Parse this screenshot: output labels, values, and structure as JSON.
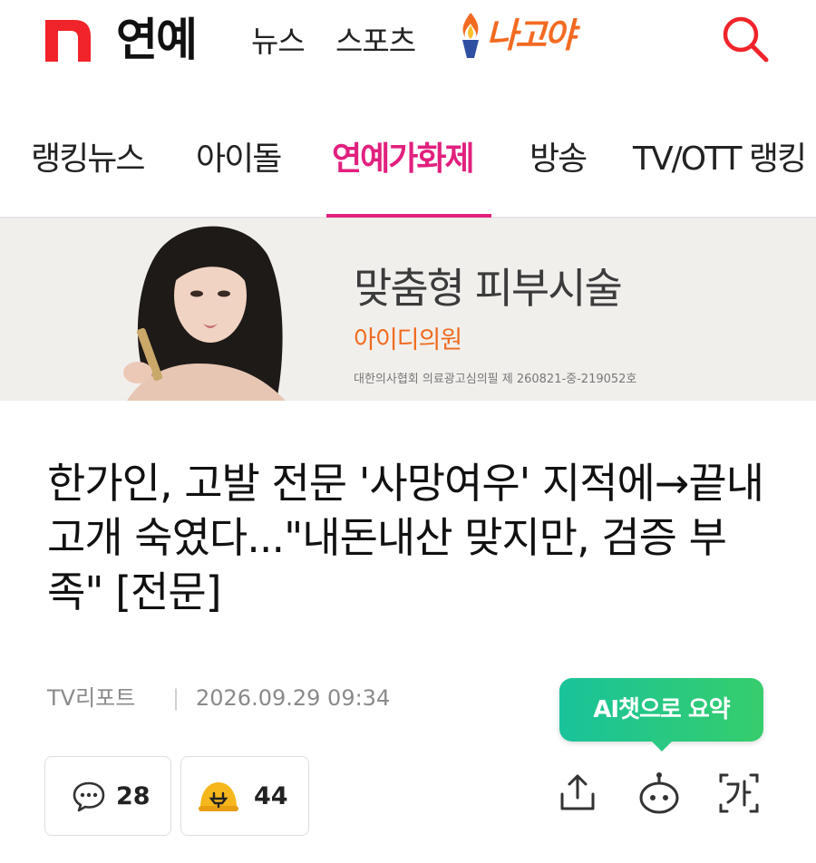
{
  "header": {
    "section_title": "연예",
    "nav_links": [
      "뉴스",
      "스포츠"
    ],
    "promo_logo_text": "나고야",
    "colors": {
      "brand_red": "#f0242a",
      "promo_orange": "#f36a22"
    }
  },
  "tabs": [
    {
      "label": "랭킹뉴스",
      "active": false
    },
    {
      "label": "아이돌",
      "active": false
    },
    {
      "label": "연예가화제",
      "active": true
    },
    {
      "label": "방송",
      "active": false
    },
    {
      "label": "TV/OTT 랭킹",
      "active": false
    }
  ],
  "active_tab_color": "#e2207e",
  "ad": {
    "headline": "맞춤형 피부시술",
    "brand": "아이디의원",
    "disclaimer": "대한의사협회 의료광고심의필 제 260821-중-219052호"
  },
  "article": {
    "title": "한가인, 고발 전문 '사망여우' 지적에→끝내 고개 숙였다...\"내돈내산 맞지만, 검증 부족\" [전문]",
    "source": "TV리포트",
    "separator": "|",
    "datetime": "2026.09.29 09:34"
  },
  "ai_summary": {
    "label": "AI챗으로 요약"
  },
  "actions": {
    "comment_count": "28",
    "reaction_count": "44",
    "icons": [
      "comment-icon",
      "reaction-icon",
      "share-icon",
      "chatbot-icon",
      "font-size-icon"
    ]
  }
}
